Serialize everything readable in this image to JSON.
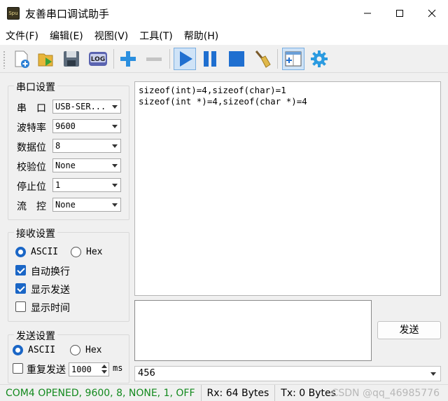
{
  "window": {
    "title": "友善串口调试助手",
    "app_icon_text": "Spu"
  },
  "menu": [
    "文件(F)",
    "编辑(E)",
    "视图(V)",
    "工具(T)",
    "帮助(H)"
  ],
  "serial_settings": {
    "title": "串口设置",
    "rows": [
      {
        "label": "串　口",
        "value": "USB-SER..."
      },
      {
        "label": "波特率",
        "value": "9600"
      },
      {
        "label": "数据位",
        "value": "8"
      },
      {
        "label": "校验位",
        "value": "None"
      },
      {
        "label": "停止位",
        "value": "1"
      },
      {
        "label": "流　控",
        "value": "None"
      }
    ]
  },
  "receive_settings": {
    "title": "接收设置",
    "ascii_label": "ASCII",
    "hex_label": "Hex",
    "auto_newline": "自动换行",
    "show_send": "显示发送",
    "show_time": "显示时间"
  },
  "send_settings": {
    "title": "发送设置",
    "ascii_label": "ASCII",
    "hex_label": "Hex",
    "repeat_label": "重复发送",
    "interval": "1000",
    "unit": "ms"
  },
  "receive_text": "sizeof(int)=4,sizeof(char)=1\nsizeof(int *)=4,sizeof(char *)=4",
  "send_button": "发送",
  "history_value": "456",
  "status": {
    "port": "COM4 OPENED, 9600, 8, NONE, 1, OFF",
    "rx": "Rx: 64 Bytes",
    "tx": "Tx: 0 Bytes",
    "watermark": "CSDN @qq_46985776"
  },
  "colors": {
    "status_green": "#138a1e",
    "accent_blue": "#1a66c6"
  }
}
